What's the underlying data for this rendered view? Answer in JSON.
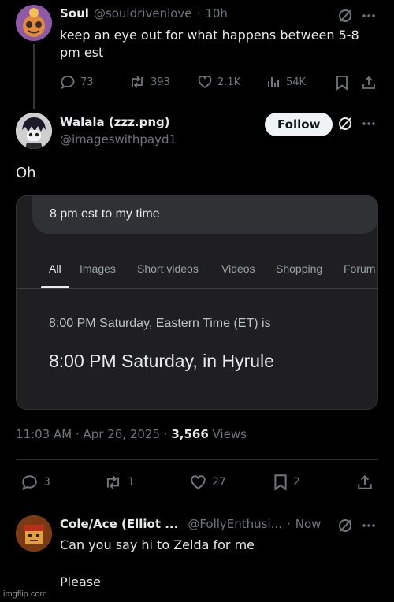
{
  "post1": {
    "display_name": "Soul",
    "handle": "@souldrivenlove",
    "sep": "·",
    "time": "10h",
    "text": "keep an eye out for what happens between 5-8 pm est",
    "replies": "73",
    "reposts": "393",
    "likes": "2.1K",
    "views": "54K"
  },
  "post2": {
    "display_name": "Walala (zzz.png)",
    "handle": "@imageswithpayd1",
    "follow_label": "Follow",
    "text": "Oh",
    "timestamp": "11:03 AM · Apr 26, 2025 · ",
    "view_count": "3,566",
    "views_label": " Views",
    "replies": "3",
    "reposts": "1",
    "likes": "27",
    "bookmarks": "2",
    "embedded_image": {
      "search_query": "8 pm est to my time",
      "tabs": [
        "All",
        "Images",
        "Short videos",
        "Videos",
        "Shopping",
        "Forum"
      ],
      "result_line1": "8:00 PM Saturday, Eastern Time (ET) is",
      "result_line2": "8:00 PM Saturday, in Hyrule"
    }
  },
  "post3": {
    "display_name": "Cole/Ace (Elliot ...",
    "handle": "@FollyEnthusi...",
    "sep": "·",
    "time": "Now",
    "text_line1": "Can you say hi to Zelda for me",
    "text_line2": "Please"
  },
  "watermark": "imgflip.com",
  "colors": {
    "background": "#000000",
    "text": "#e7e9ea",
    "muted": "#71767b",
    "divider": "#2f3336",
    "follow_button": "#eff3f4"
  }
}
